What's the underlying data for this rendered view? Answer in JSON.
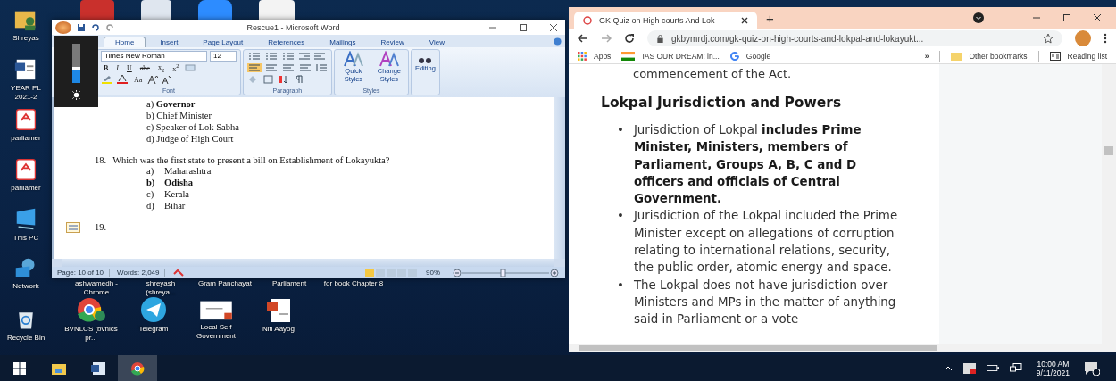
{
  "desktop": {
    "top_icons": [
      {
        "kind": "red-app"
      },
      {
        "kind": "document"
      },
      {
        "kind": "video-app"
      },
      {
        "kind": "blank"
      }
    ],
    "left_icons": [
      {
        "label": "Shreyas",
        "kind": "user-folder"
      },
      {
        "label": "YEAR PL 2021-2",
        "kind": "document"
      },
      {
        "label": "parliamer",
        "kind": "pdf"
      },
      {
        "label": "parliamer",
        "kind": "pdf"
      },
      {
        "label": "This PC",
        "kind": "computer"
      },
      {
        "label": "Network",
        "kind": "network"
      },
      {
        "label": "Recycle Bin",
        "kind": "recycle"
      }
    ],
    "row_labels": [
      "ashwamedh - Chrome",
      "shreyash (shreya...",
      "Gram Panchayat",
      "Parliament",
      "for book Chapter 8"
    ],
    "row_icons": [
      {
        "label": "BVNLCS (bvnlcs pr...",
        "kind": "chrome"
      },
      {
        "label": "Telegram",
        "kind": "telegram"
      },
      {
        "label": "Local Self Government",
        "kind": "slide"
      },
      {
        "label": "Niti Aayog",
        "kind": "presentation"
      }
    ]
  },
  "brightness": {
    "level": 0.4
  },
  "word": {
    "title": "Rescue1 - Microsoft Word",
    "tabs": [
      {
        "label": "Home",
        "selected": true
      },
      {
        "label": "Insert",
        "selected": false
      },
      {
        "label": "Page Layout",
        "selected": false
      },
      {
        "label": "References",
        "selected": false
      },
      {
        "label": "Mailings",
        "selected": false
      },
      {
        "label": "Review",
        "selected": false
      },
      {
        "label": "View",
        "selected": false
      }
    ],
    "font_name": "Times New Roman",
    "font_size": "12",
    "format_buttons": [
      "B",
      "I",
      "U",
      "abe",
      "x$_{2}$",
      "x$^{2}$"
    ],
    "case_button": "Aa",
    "groups": {
      "font": "Font",
      "paragraph": "Paragraph",
      "styles": "Styles"
    },
    "styles_buttons": [
      "Quick Styles",
      "Change Styles"
    ],
    "editing": "Editing",
    "document": [
      {
        "kind": "option",
        "text": "a) **Governor**"
      },
      {
        "kind": "option",
        "text": "b) Chief Minister"
      },
      {
        "kind": "option",
        "text": "c) Speaker of Lok Sabha"
      },
      {
        "kind": "option",
        "text": "d) Judge of High Court"
      },
      {
        "kind": "question",
        "marker": "18.",
        "text": "Which was the first state to present a bill on Establishment of Lokayukta?"
      },
      {
        "kind": "choice",
        "marker": "a)",
        "text": "Maharashtra",
        "bold": false
      },
      {
        "kind": "choice",
        "marker": "b)",
        "text": "Odisha",
        "bold": true
      },
      {
        "kind": "choice",
        "marker": "c)",
        "text": "Kerala",
        "bold": false
      },
      {
        "kind": "choice",
        "marker": "d)",
        "text": "Bihar",
        "bold": false
      },
      {
        "kind": "question",
        "marker": "19."
      }
    ],
    "status": {
      "page": "Page: 10 of 10",
      "words": "Words: 2,049",
      "zoom": "90%"
    }
  },
  "browser": {
    "tab_title": "GK Quiz on High courts And Lok",
    "new_tab": "+",
    "url": "gkbymrdj.com/gk-quiz-on-high-courts-and-lokpal-and-lokayukt...",
    "bookmarks": [
      {
        "label": "Apps",
        "kind": "apps"
      },
      {
        "label": "IAS OUR DREAM: in...",
        "kind": "flag"
      },
      {
        "label": "Google",
        "kind": "google"
      }
    ],
    "overflow": "»",
    "other_bookmarks": "Other bookmarks",
    "reading_list": "Reading list",
    "lead": "commencement of the Act.",
    "heading": "Lokpal Jurisdiction and Powers",
    "bullets": [
      {
        "marker": "•",
        "text": "Jurisdiction of Lokpal **includes Prime Minister, Ministers, members of Parliament, Groups A, B, C and D officers and officials of Central Government.**"
      },
      {
        "marker": "•",
        "text": "Jurisdiction of the Lokpal included the Prime Minister except on allegations of corruption relating to international relations, security, the public order, atomic energy and space."
      },
      {
        "marker": "•",
        "text": "The Lokpal does not have jurisdiction over Ministers and MPs in the matter of anything said in Parliament or a vote"
      }
    ]
  },
  "taskbar": {
    "apps": [
      {
        "kind": "start",
        "selected": false
      },
      {
        "kind": "explorer",
        "selected": false
      },
      {
        "kind": "word",
        "selected": false
      },
      {
        "kind": "chrome",
        "selected": true
      }
    ],
    "time": "10:00 AM",
    "date": "9/11/2021"
  }
}
